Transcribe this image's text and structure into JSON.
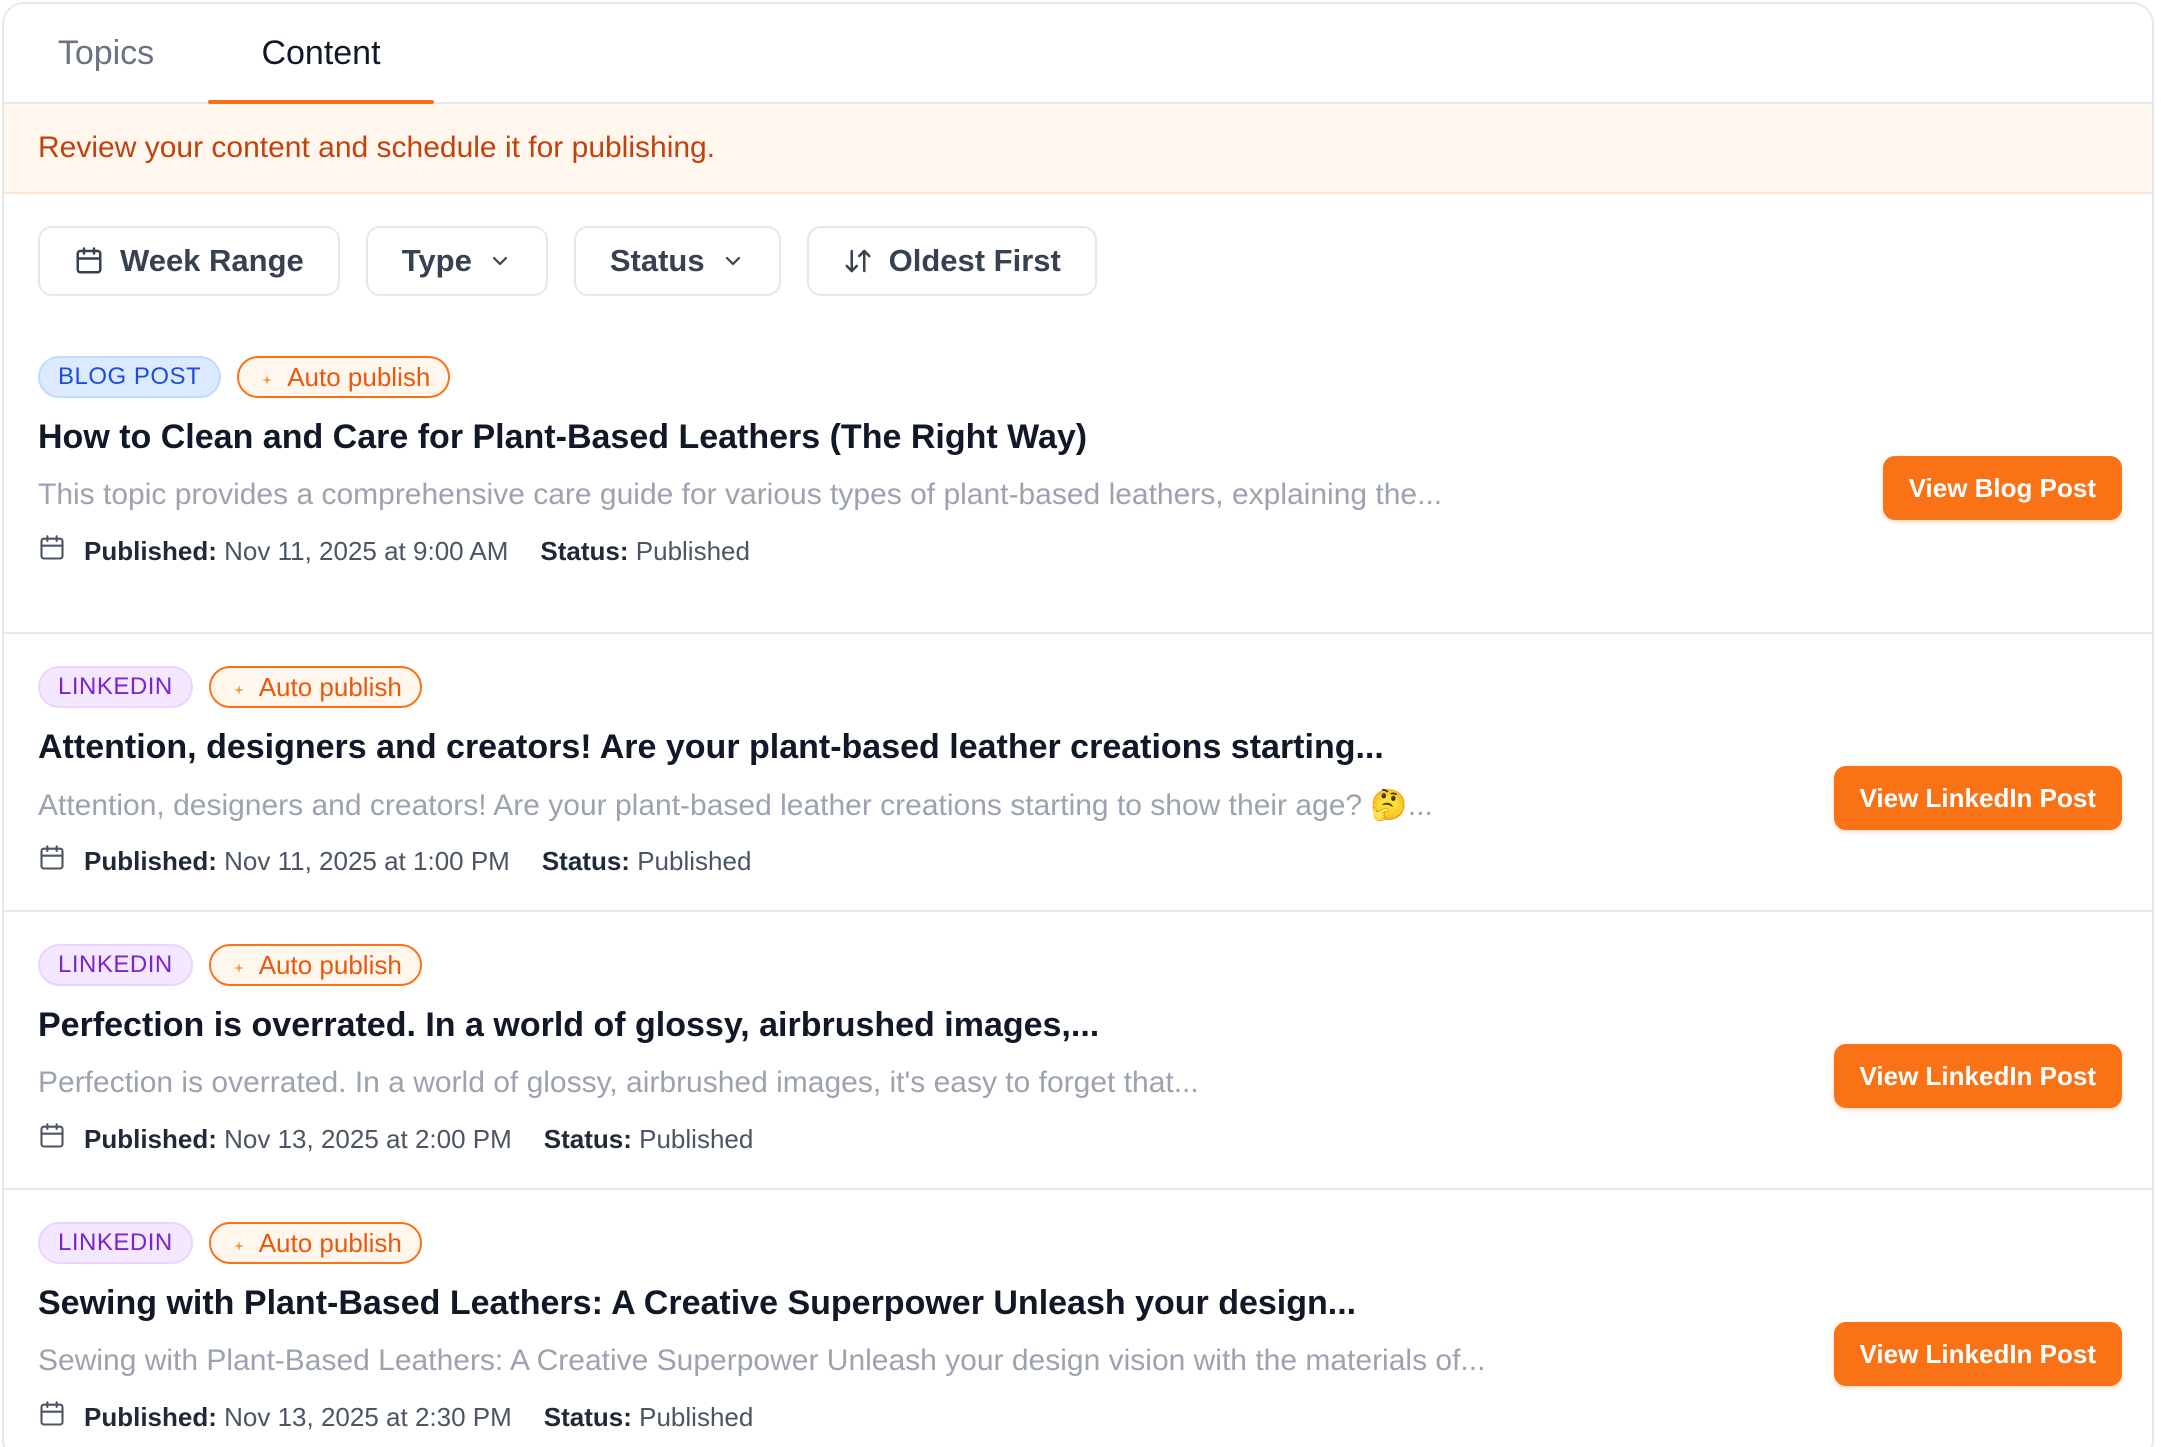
{
  "tabs": [
    {
      "label": "Topics"
    },
    {
      "label": "Content"
    }
  ],
  "notice": "Review your content and schedule it for publishing.",
  "filters": {
    "week_range": "Week Range",
    "type": "Type",
    "status": "Status",
    "sort": "Oldest First"
  },
  "labels": {
    "published": "Published:",
    "status": "Status:",
    "auto_publish": "Auto publish"
  },
  "items": [
    {
      "type": "BLOG POST",
      "title": "How to Clean and Care for Plant-Based Leathers (The Right Way)",
      "description": "This topic provides a comprehensive care guide for various types of plant-based leathers, explaining the...",
      "published": "Nov 11, 2025 at 9:00 AM",
      "status": "Published",
      "button": "View Blog Post"
    },
    {
      "type": "LINKEDIN",
      "title": "Attention, designers and creators! Are your plant-based leather creations starting...",
      "description": "Attention, designers and creators! Are your plant-based leather creations starting to show their age? 🤔...",
      "published": "Nov 11, 2025 at 1:00 PM",
      "status": "Published",
      "button": "View LinkedIn Post"
    },
    {
      "type": "LINKEDIN",
      "title": "Perfection is overrated. In a world of glossy, airbrushed images,...",
      "description": "Perfection is overrated. In a world of glossy, airbrushed images, it's easy to forget that...",
      "published": "Nov 13, 2025 at 2:00 PM",
      "status": "Published",
      "button": "View LinkedIn Post"
    },
    {
      "type": "LINKEDIN",
      "title": "Sewing with Plant-Based Leathers: A Creative Superpower Unleash your design...",
      "description": "Sewing with Plant-Based Leathers: A Creative Superpower Unleash your design vision with the materials of...",
      "published": "Nov 13, 2025 at 2:30 PM",
      "status": "Published",
      "button": "View LinkedIn Post"
    }
  ],
  "colors": {
    "accent": "#f97316",
    "notice_bg": "#fff7ed",
    "blog_badge": "#dbeafe",
    "linkedin_badge": "#f3e8ff"
  }
}
